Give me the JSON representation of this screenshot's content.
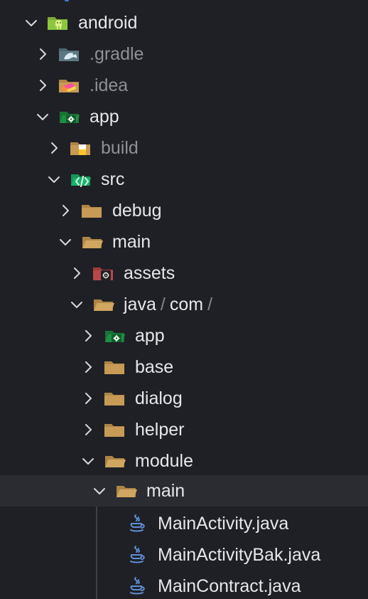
{
  "tree": {
    "rows": [
      {
        "name": "android",
        "expanded": true,
        "muted": false,
        "icon": "android-folder-icon"
      },
      {
        "name": ".gradle",
        "expanded": false,
        "muted": true,
        "icon": "gradle-folder-icon"
      },
      {
        "name": ".idea",
        "expanded": false,
        "muted": true,
        "icon": "idea-folder-icon"
      },
      {
        "name": "app",
        "expanded": true,
        "muted": false,
        "icon": "app-folder-icon"
      },
      {
        "name": "build",
        "expanded": false,
        "muted": true,
        "icon": "build-folder-icon"
      },
      {
        "name": "src",
        "expanded": true,
        "muted": false,
        "icon": "source-folder-icon"
      },
      {
        "name": "debug",
        "expanded": false,
        "muted": false,
        "icon": "folder-icon"
      },
      {
        "name": "main",
        "expanded": true,
        "muted": false,
        "icon": "folder-open-icon"
      },
      {
        "name": "assets",
        "expanded": false,
        "muted": false,
        "icon": "assets-folder-icon"
      },
      {
        "name": "java",
        "compact_path": [
          "java",
          "/",
          "com",
          "/"
        ],
        "expanded": true,
        "muted": false,
        "icon": "folder-open-icon"
      },
      {
        "name": "app",
        "expanded": false,
        "muted": false,
        "icon": "app-folder-icon"
      },
      {
        "name": "base",
        "expanded": false,
        "muted": false,
        "icon": "folder-icon"
      },
      {
        "name": "dialog",
        "expanded": false,
        "muted": false,
        "icon": "folder-icon"
      },
      {
        "name": "helper",
        "expanded": false,
        "muted": false,
        "icon": "folder-icon"
      },
      {
        "name": "module",
        "expanded": true,
        "muted": false,
        "icon": "folder-open-icon"
      },
      {
        "name": "main",
        "expanded": true,
        "muted": false,
        "icon": "folder-open-icon",
        "selected": true
      },
      {
        "name": "MainActivity.java",
        "muted": false,
        "icon": "java-file-icon"
      },
      {
        "name": "MainActivityBak.java",
        "muted": false,
        "icon": "java-file-icon"
      },
      {
        "name": "MainContract.java",
        "muted": false,
        "icon": "java-file-icon"
      }
    ]
  },
  "colors": {
    "background": "#1f2025",
    "selected_row": "#2a2c31",
    "text": "#e7e7ea",
    "muted_text": "#8f9096",
    "separator_text": "#86878d",
    "folder": "#c79a55",
    "android_green": "#8cc63f",
    "app_green": "#1f8f43",
    "source_green": "#18b36b",
    "java_blue": "#5e8ed6"
  }
}
